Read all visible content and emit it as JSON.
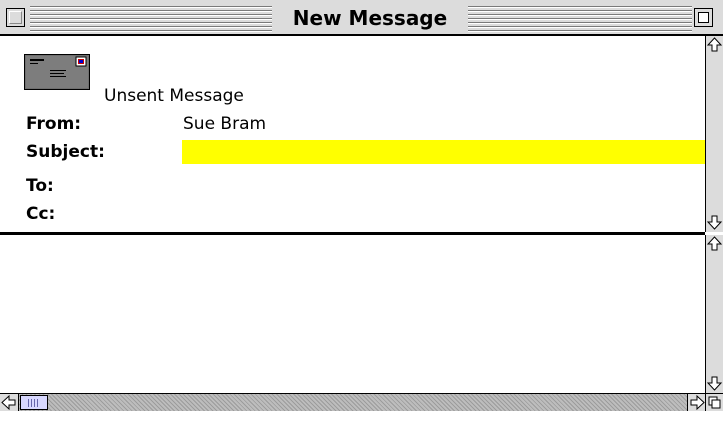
{
  "window": {
    "title": "New Message"
  },
  "header": {
    "status_text": "Unsent Message",
    "icon": "envelope-icon",
    "from_label": "From:",
    "from_value": "Sue Bram",
    "subject_label": "Subject:",
    "subject_value": "",
    "to_label": "To:",
    "cc_label": "Cc:"
  },
  "body": {
    "text": ""
  },
  "colors": {
    "subject_highlight": "#ffff00",
    "chrome": "#dcdcdc",
    "thumb": "#d8d8ff"
  }
}
